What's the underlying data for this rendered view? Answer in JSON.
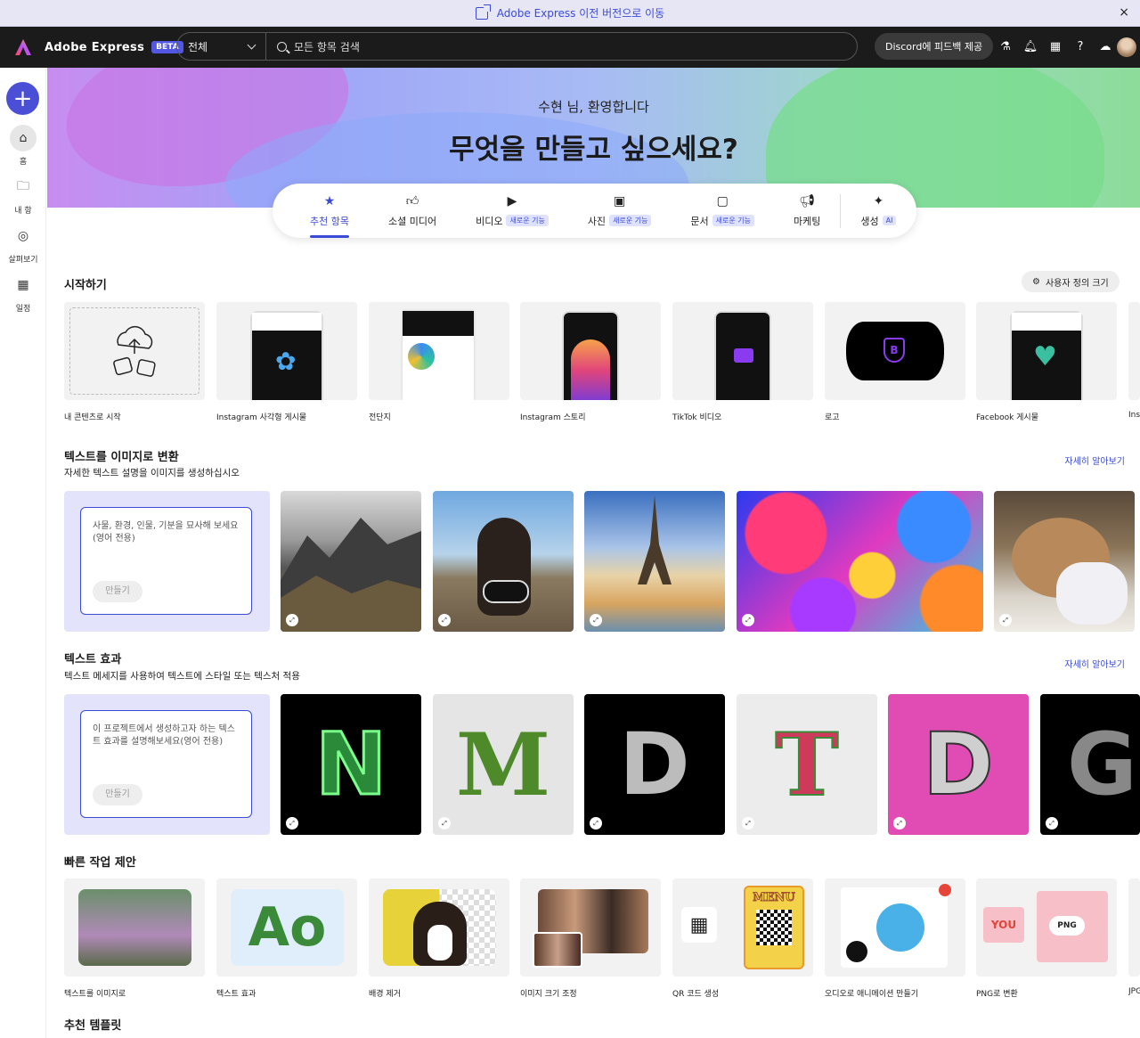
{
  "banner": {
    "text": "Adobe Express 이전 버전으로 이동",
    "close": "×"
  },
  "topbar": {
    "app_name": "Adobe Express",
    "beta": "BETA",
    "scope": "전체",
    "search_placeholder": "모든 항목 검색",
    "discord": "Discord에 피드백 제공"
  },
  "leftnav": {
    "items": [
      {
        "label": "홈",
        "icon": "home-icon"
      },
      {
        "label": "내 항",
        "icon": "folder-icon"
      },
      {
        "label": "살펴보기",
        "icon": "compass-icon"
      },
      {
        "label": "일정",
        "icon": "calendar-icon"
      }
    ]
  },
  "hero": {
    "greeting": "수현 님, 환영합니다",
    "title": "무엇을 만들고 싶으세요?"
  },
  "tabs": [
    {
      "label": "추천 항목",
      "badge": ""
    },
    {
      "label": "소셜 미디어",
      "badge": ""
    },
    {
      "label": "비디오",
      "badge": "새로운 기능"
    },
    {
      "label": "사진",
      "badge": "새로운 기능"
    },
    {
      "label": "문서",
      "badge": "새로운 기능"
    },
    {
      "label": "마케팅",
      "badge": ""
    },
    {
      "label": "생성",
      "badge": "AI"
    }
  ],
  "start": {
    "title": "시작하기",
    "custom_size": "사용자 정의 크기",
    "cards": [
      {
        "label": "내 콘텐츠로 시작"
      },
      {
        "label": "Instagram 사각형 게시물"
      },
      {
        "label": "전단지"
      },
      {
        "label": "Instagram 스토리"
      },
      {
        "label": "TikTok 비디오"
      },
      {
        "label": "로고"
      },
      {
        "label": "Facebook 게시물"
      },
      {
        "label": "Ins"
      }
    ]
  },
  "t2i": {
    "title": "텍스트를 이미지로 변환",
    "subtitle": "자세한 텍스트 설명을 이미지를 생성하십시오",
    "learn": "자세히 알아보기",
    "placeholder": "사물, 환경, 인물, 기분을 묘사해 보세요(영어 전용)",
    "button": "만들기"
  },
  "effects": {
    "title": "텍스트 효과",
    "subtitle": "텍스트 메세지를 사용하여 텍스트에 스타일 또는 텍스처 적용",
    "learn": "자세히 알아보기",
    "placeholder": "이 프로젝트에서 생성하고자 하는 텍스트 효과를 설명해보세요(영어 전용)",
    "button": "만들기",
    "letters": [
      "N",
      "M",
      "D",
      "T",
      "D",
      "G"
    ]
  },
  "quick": {
    "title": "빠른 작업 제안",
    "cards": [
      {
        "label": "텍스트를 이미지로"
      },
      {
        "label": "텍스트 효과"
      },
      {
        "label": "배경 제거"
      },
      {
        "label": "이미지 크기 조정"
      },
      {
        "label": "QR 코드 생성"
      },
      {
        "label": "오디오로 애니메이션 만들기"
      },
      {
        "label": "PNG로 변환"
      },
      {
        "label": "JPG"
      }
    ],
    "menu_text": "MENU",
    "png_text": "PNG",
    "you_text": "YOU"
  },
  "templates": {
    "title": "추천 템플릿"
  }
}
